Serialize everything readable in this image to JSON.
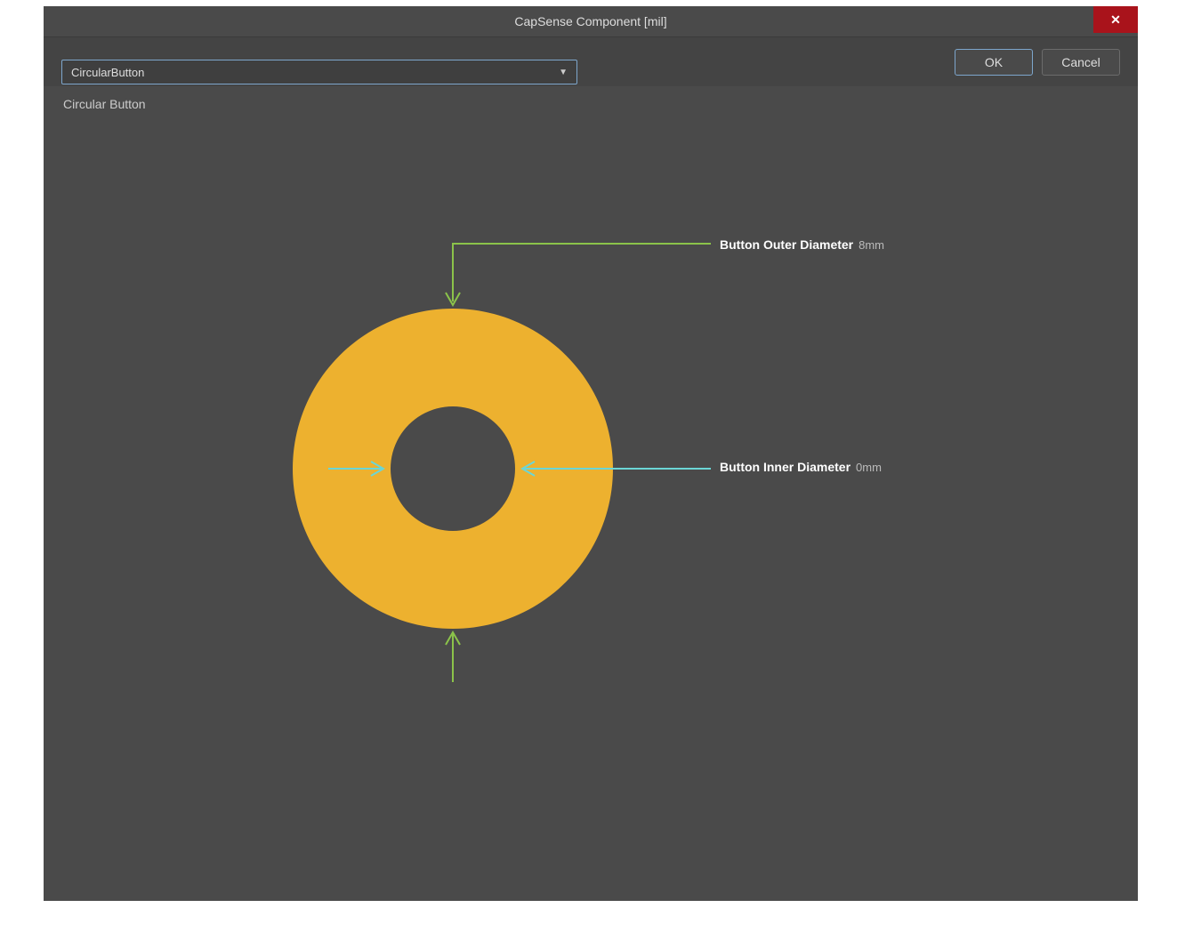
{
  "dialog": {
    "title": "CapSense Component [mil]",
    "close_symbol": "✕"
  },
  "dropdown": {
    "selected": "CircularButton"
  },
  "subtitle": "Circular Button",
  "labels": {
    "outer": {
      "text": "Button Outer Diameter",
      "value": "8mm"
    },
    "inner": {
      "text": "Button Inner Diameter",
      "value": "0mm"
    }
  },
  "footer": {
    "ok": "OK",
    "cancel": "Cancel"
  },
  "colors": {
    "ring": "#edb12f",
    "green_line": "#8bc34a",
    "cyan_line": "#6bd6d6"
  }
}
